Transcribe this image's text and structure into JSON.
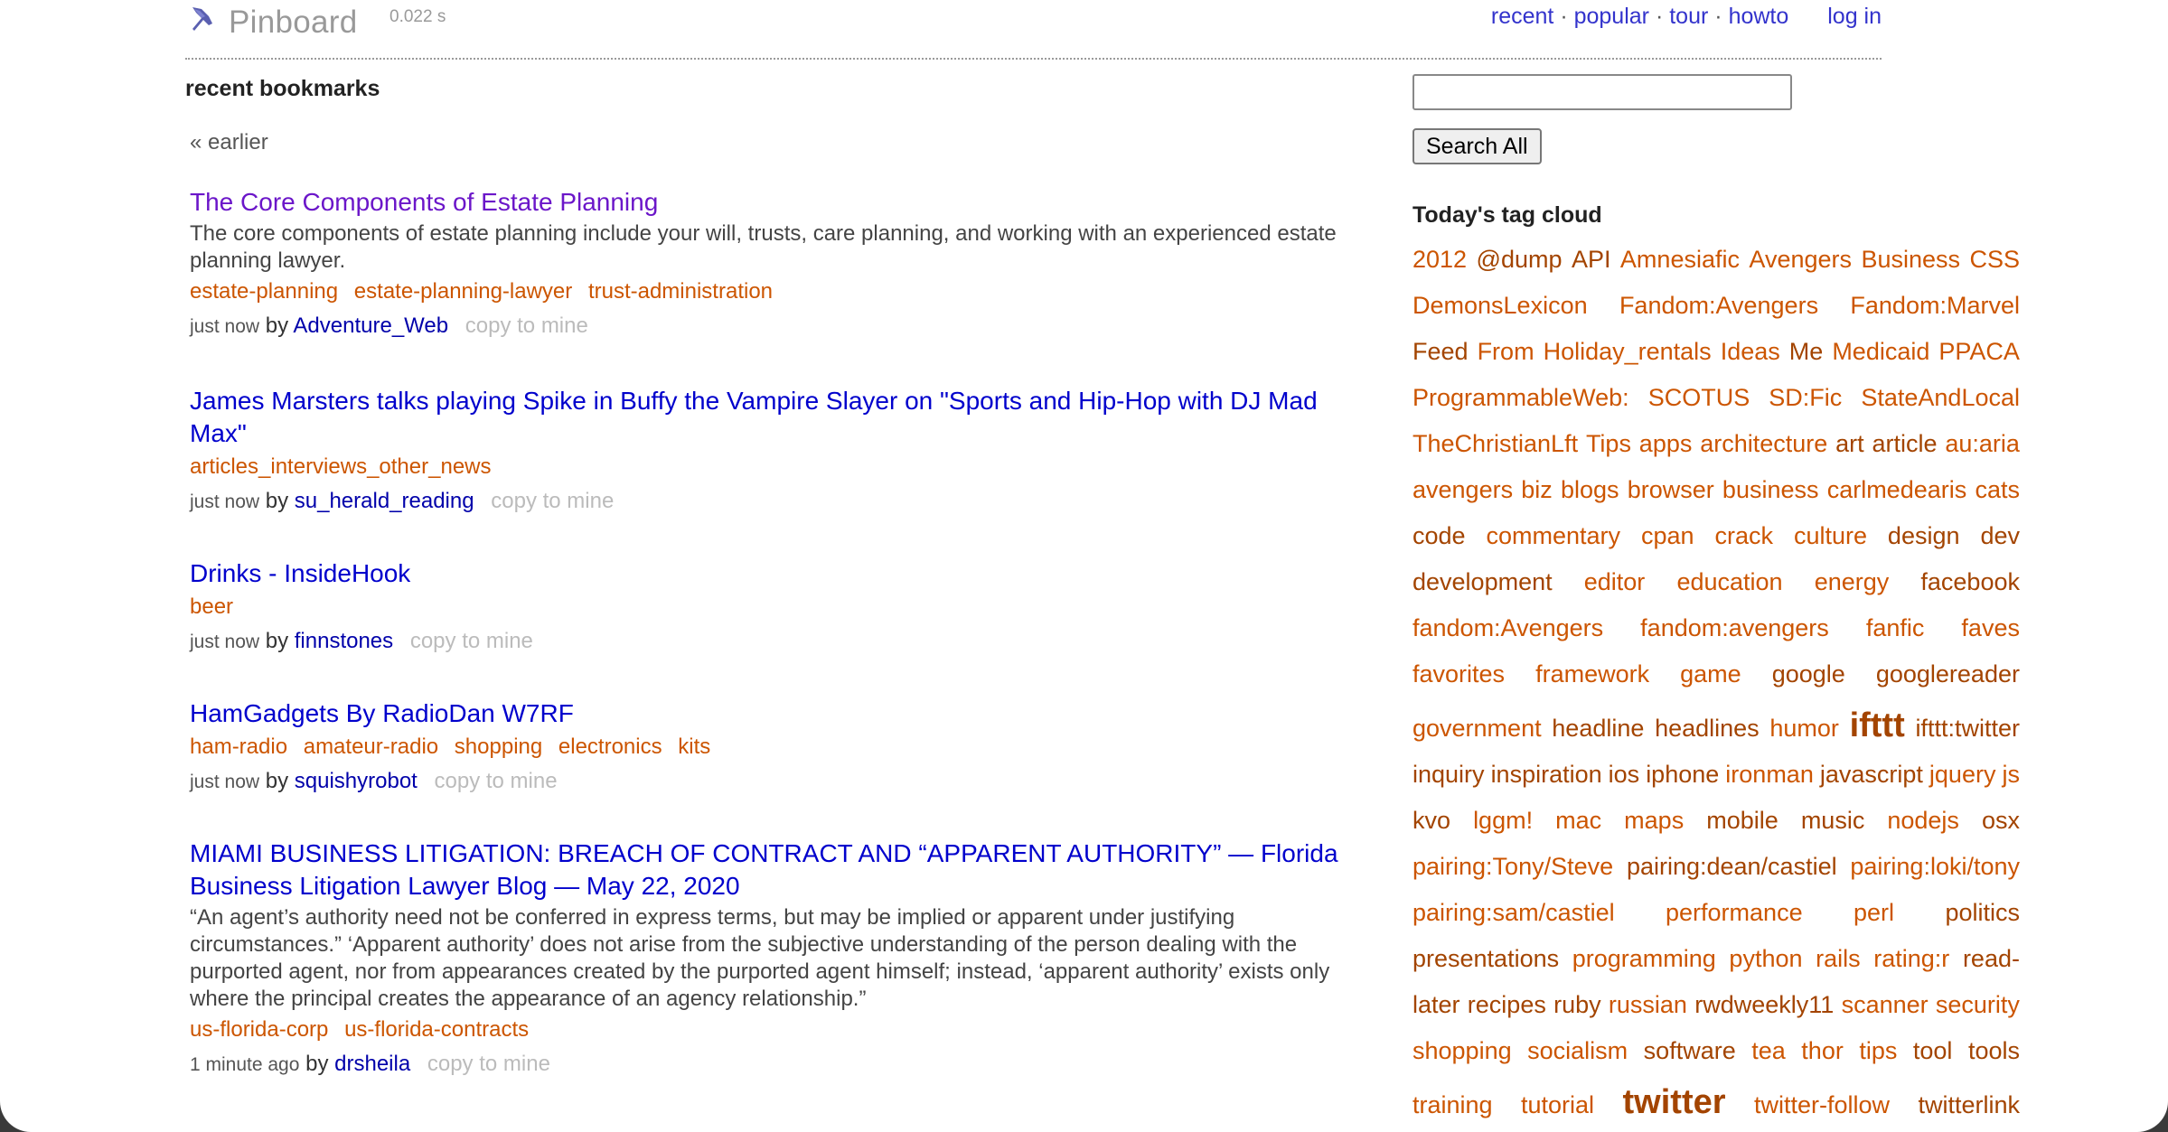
{
  "header": {
    "logo_text": "Pinboard",
    "timing": "0.022 s",
    "nav": {
      "recent": "recent",
      "popular": "popular",
      "tour": "tour",
      "howto": "howto",
      "separator": "·",
      "login": "log in"
    }
  },
  "main": {
    "section_title": "recent bookmarks",
    "earlier": "« earlier",
    "by_label": "by",
    "copy_label": "copy to mine",
    "bookmarks": [
      {
        "title": "The Core Components of Estate Planning",
        "visited": true,
        "description": "The core components of estate planning include your will, trusts, care planning, and working with an experienced estate planning lawyer.",
        "tags": [
          "estate-planning",
          "estate-planning-lawyer",
          "trust-administration"
        ],
        "time": "just now",
        "user": "Adventure_Web"
      },
      {
        "title": "James Marsters talks playing Spike in Buffy the Vampire Slayer on \"Sports and Hip-Hop with DJ Mad Max\"",
        "visited": false,
        "description": "",
        "tags": [
          "articles_interviews_other_news"
        ],
        "time": "just now",
        "user": "su_herald_reading"
      },
      {
        "title": "Drinks - InsideHook",
        "visited": false,
        "description": "",
        "tags": [
          "beer"
        ],
        "time": "just now",
        "user": "finnstones"
      },
      {
        "title": "HamGadgets By RadioDan W7RF",
        "visited": false,
        "description": "",
        "tags": [
          "ham-radio",
          "amateur-radio",
          "shopping",
          "electronics",
          "kits"
        ],
        "time": "just now",
        "user": "squishyrobot"
      },
      {
        "title": "MIAMI BUSINESS LITIGATION: BREACH OF CONTRACT AND “APPARENT AUTHORITY” — Florida Business Litigation Lawyer Blog — May 22, 2020",
        "visited": false,
        "description": "“An agent’s authority need not be conferred in express terms, but may be implied or apparent under justifying circumstances.” ‘Apparent authority’ does not arise from the subjective understanding of the person dealing with the purported agent, nor from appearances created by the purported agent himself; instead, ‘apparent authority’ exists only where the principal creates the appearance of an agency relationship.”",
        "tags": [
          "us-florida-corp",
          "us-florida-contracts"
        ],
        "time": "1 minute ago",
        "user": "drsheila"
      }
    ]
  },
  "sidebar": {
    "search_placeholder": "",
    "search_button": "Search All",
    "tag_cloud_title": "Today's tag cloud",
    "tag_cloud_lines": [
      [
        {
          "t": "2012"
        },
        {
          "t": "@dump",
          "w": 1
        },
        {
          "t": "API",
          "w": 1
        },
        {
          "t": "Amnesiafic"
        },
        {
          "t": "Avengers"
        },
        {
          "t": "Business"
        },
        {
          "t": "CSS"
        }
      ],
      [
        {
          "t": "DemonsLexicon"
        },
        {
          "t": "Fandom:Avengers"
        },
        {
          "t": "Fandom:Marvel"
        }
      ],
      [
        {
          "t": "Feed",
          "w": 1
        },
        {
          "t": "From"
        },
        {
          "t": "Holiday_rentals"
        },
        {
          "t": "Ideas"
        },
        {
          "t": "Me",
          "w": 1
        },
        {
          "t": "Medicaid"
        },
        {
          "t": "PPACA"
        }
      ],
      [
        {
          "t": "ProgrammableWeb:"
        },
        {
          "t": "SCOTUS"
        },
        {
          "t": "SD:Fic"
        },
        {
          "t": "StateAndLocal"
        }
      ],
      [
        {
          "t": "TheChristianLft"
        },
        {
          "t": "Tips"
        },
        {
          "t": "apps"
        },
        {
          "t": "architecture"
        },
        {
          "t": "art",
          "w": 1
        },
        {
          "t": "article",
          "w": 1
        },
        {
          "t": "au:aria"
        }
      ],
      [
        {
          "t": "avengers"
        },
        {
          "t": "biz"
        },
        {
          "t": "blogs"
        },
        {
          "t": "browser"
        },
        {
          "t": "business"
        },
        {
          "t": "carlmedearis"
        },
        {
          "t": "cats"
        }
      ],
      [
        {
          "t": "code",
          "w": 1
        },
        {
          "t": "commentary"
        },
        {
          "t": "cpan"
        },
        {
          "t": "crack"
        },
        {
          "t": "culture"
        },
        {
          "t": "design",
          "w": 1
        },
        {
          "t": "dev",
          "w": 1
        }
      ],
      [
        {
          "t": "development",
          "w": 1
        },
        {
          "t": "editor"
        },
        {
          "t": "education"
        },
        {
          "t": "energy"
        },
        {
          "t": "facebook",
          "w": 1
        }
      ],
      [
        {
          "t": "fandom:Avengers"
        },
        {
          "t": "fandom:avengers"
        },
        {
          "t": "fanfic"
        },
        {
          "t": "faves"
        }
      ],
      [
        {
          "t": "favorites"
        },
        {
          "t": "framework"
        },
        {
          "t": "game"
        },
        {
          "t": "google",
          "w": 1
        },
        {
          "t": "googlereader",
          "w": 1
        }
      ],
      [
        {
          "t": "government"
        },
        {
          "t": "headline",
          "w": 1
        },
        {
          "t": "headlines",
          "w": 1
        },
        {
          "t": "humor"
        },
        {
          "t": "ifttt",
          "big": 1
        },
        {
          "t": "ifttt:twitter",
          "w": 1
        }
      ],
      [
        {
          "t": "inquiry",
          "w": 1
        },
        {
          "t": "inspiration",
          "w": 1
        },
        {
          "t": "ios",
          "w": 1
        },
        {
          "t": "iphone",
          "w": 1
        },
        {
          "t": "ironman"
        },
        {
          "t": "javascript",
          "w": 1
        },
        {
          "t": "jquery"
        },
        {
          "t": "js"
        }
      ],
      [
        {
          "t": "kvo",
          "w": 1
        },
        {
          "t": "lggm!"
        },
        {
          "t": "mac"
        },
        {
          "t": "maps"
        },
        {
          "t": "mobile",
          "w": 1
        },
        {
          "t": "music",
          "w": 1
        },
        {
          "t": "nodejs"
        },
        {
          "t": "osx",
          "w": 1
        }
      ],
      [
        {
          "t": "pairing:Tony/Steve"
        },
        {
          "t": "pairing:dean/castiel",
          "w": 1
        },
        {
          "t": "pairing:loki/tony"
        }
      ],
      [
        {
          "t": "pairing:sam/castiel"
        },
        {
          "t": "performance"
        },
        {
          "t": "perl"
        },
        {
          "t": "politics",
          "w": 1
        }
      ],
      [
        {
          "t": "presentations",
          "w": 1
        },
        {
          "t": "programming"
        },
        {
          "t": "python"
        },
        {
          "t": "rails"
        },
        {
          "t": "rating:r"
        },
        {
          "t": "read-",
          "w": 1
        }
      ],
      [
        {
          "t": "later",
          "w": 1
        },
        {
          "t": "recipes",
          "w": 1
        },
        {
          "t": "ruby",
          "w": 1
        },
        {
          "t": "russian"
        },
        {
          "t": "rwdweekly11",
          "w": 1
        },
        {
          "t": "scanner"
        },
        {
          "t": "security"
        }
      ],
      [
        {
          "t": "shopping"
        },
        {
          "t": "socialism"
        },
        {
          "t": "software",
          "w": 1
        },
        {
          "t": "tea"
        },
        {
          "t": "thor"
        },
        {
          "t": "tips"
        },
        {
          "t": "tool",
          "w": 1
        },
        {
          "t": "tools",
          "w": 1
        }
      ],
      [
        {
          "t": "training"
        },
        {
          "t": "tutorial"
        },
        {
          "t": "twitter",
          "big": 1
        },
        {
          "t": "twitter-follow"
        },
        {
          "t": "twitterlink",
          "w": 1
        }
      ]
    ]
  },
  "colors": {
    "link": "#0000cc",
    "visited": "#6b16c9",
    "tag": "#cc5500",
    "muted": "#bbbbbb"
  }
}
